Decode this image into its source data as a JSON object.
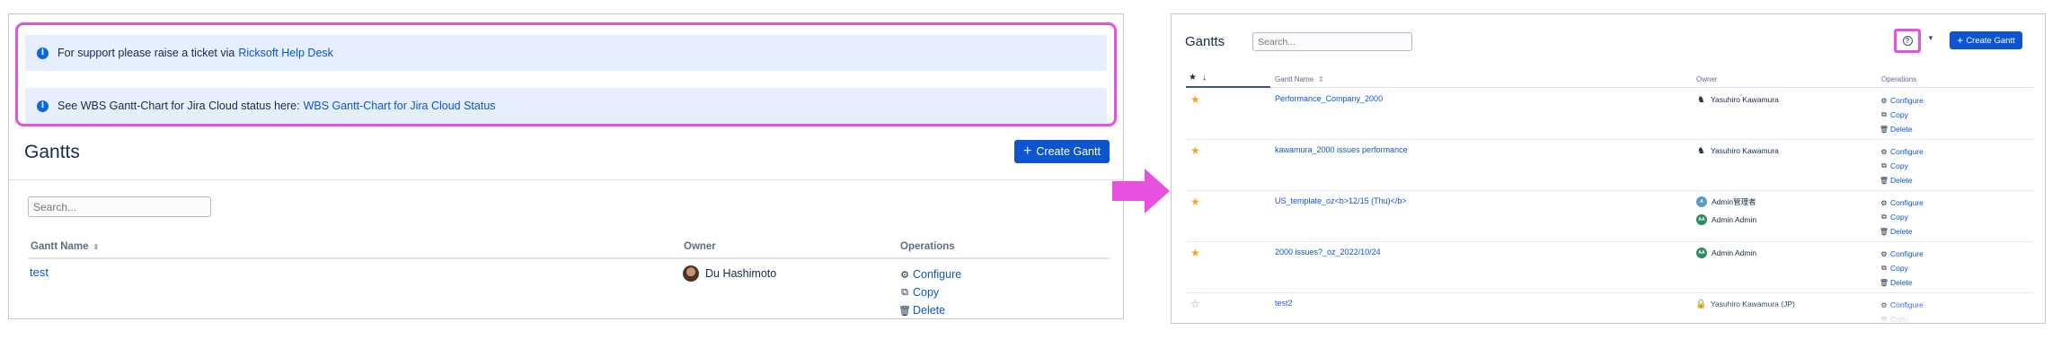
{
  "left": {
    "notices": [
      {
        "icon": "info-icon",
        "text": "For support please raise a ticket via",
        "link": "Ricksoft Help Desk"
      },
      {
        "icon": "info-icon",
        "text": "See WBS Gantt-Chart for Jira Cloud status here:",
        "link": "WBS Gantt-Chart for Jira Cloud Status"
      }
    ],
    "title": "Gantts",
    "create_button": "Create Gantt",
    "search_placeholder": "Search...",
    "columns": {
      "name": "Gantt Name",
      "owner": "Owner",
      "operations": "Operations"
    },
    "row": {
      "name": "test",
      "owner": "Du Hashimoto"
    },
    "ops": {
      "configure": "Configure",
      "copy": "Copy",
      "delete": "Delete"
    }
  },
  "right": {
    "title": "Gantts",
    "search_placeholder": "Search...",
    "create_button": "Create Gantt",
    "columns": {
      "name": "Gantt Name",
      "owner": "Owner",
      "operations": "Operations"
    },
    "ops": {
      "configure": "Configure",
      "copy": "Copy",
      "delete": "Delete"
    },
    "rows": [
      {
        "starred": true,
        "name": "Performance_Company_2000",
        "owners": [
          {
            "name": "Yasuhiro Kawamura",
            "avatar": "person-icon"
          }
        ]
      },
      {
        "starred": true,
        "name": "kawamura_2000 issues performance",
        "owners": [
          {
            "name": "Yasuhiro Kawamura",
            "avatar": "person-icon"
          }
        ]
      },
      {
        "starred": true,
        "name": "US_template_oz<b>12/15 (Thu)</b>",
        "owners": [
          {
            "name": "Admin管理者",
            "initials": "A",
            "color": "#5a9ac8"
          },
          {
            "name": "Admin Admin",
            "initials": "AA",
            "color": "#2d8a63"
          }
        ]
      },
      {
        "starred": true,
        "name": "2000 issues?_oz_2022/10/24",
        "owners": [
          {
            "name": "Admin Admin",
            "initials": "AA",
            "color": "#2d8a63"
          }
        ]
      },
      {
        "starred": false,
        "name": "test2",
        "owners": [
          {
            "name": "Yasuhiro Kawamura (JP)",
            "avatar": "lock-avatar-icon"
          }
        ]
      }
    ]
  },
  "colors": {
    "accent": "#0c55cf",
    "highlight": "#e651e0",
    "star": "#f5a623",
    "notice_bg": "#e6efff"
  }
}
